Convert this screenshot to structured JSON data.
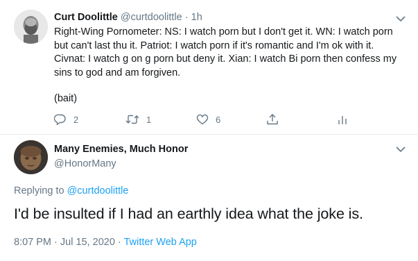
{
  "parent_tweet": {
    "author_name": "Curt Doolittle",
    "author_handle": "@curtdoolittle",
    "separator": "·",
    "time": "1h",
    "text": "Right-Wing Pornometer: NS: I watch porn but I don't get it. WN: I watch porn but can't last thu it. Patriot: I watch porn if it's romantic and I'm ok with it. Civnat: I watch g on g porn but deny it. Xian: I watch Bi porn then confess my sins to god and am forgiven.",
    "text_2": "(bait)",
    "actions": {
      "reply_count": "2",
      "retweet_count": "1",
      "like_count": "6"
    }
  },
  "reply_tweet": {
    "author_name": "Many Enemies, Much Honor",
    "author_handle": "@HonorMany",
    "replying_prefix": "Replying to",
    "replying_to": "@curtdoolittle",
    "text": "I'd be insulted if I had an earthly idea what the joke is.",
    "timestamp": "8:07 PM · Jul 15, 2020",
    "separator": "·",
    "source": "Twitter Web App"
  },
  "icons": {
    "chevron": "chevron-down-icon",
    "reply": "reply-icon",
    "retweet": "retweet-icon",
    "like": "heart-icon",
    "share": "share-icon",
    "analytics": "analytics-icon"
  },
  "colors": {
    "text": "#14171a",
    "secondary": "#657786",
    "link": "#1da1f2",
    "divider": "#e6ecf0"
  }
}
